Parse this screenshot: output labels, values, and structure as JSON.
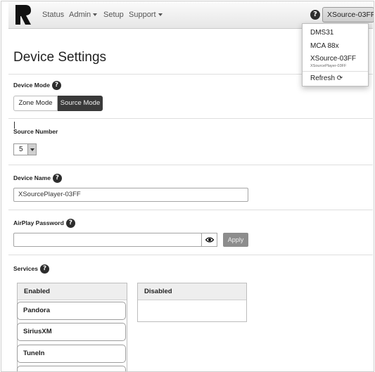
{
  "nav": {
    "items": [
      {
        "label": "Status",
        "dropdown": false
      },
      {
        "label": "Admin",
        "dropdown": true
      },
      {
        "label": "Setup",
        "dropdown": false
      },
      {
        "label": "Support",
        "dropdown": true
      }
    ],
    "help_glyph": "?",
    "device_button_label": "XSource-03FF"
  },
  "device_menu": {
    "items": [
      {
        "label": "DMS31"
      },
      {
        "label": "MCA 88x"
      },
      {
        "label": "XSource-03FF",
        "sublabel": "XSourcePlayer-03FF"
      }
    ],
    "refresh_label": "Refresh",
    "refresh_icon": "refresh-icon"
  },
  "page": {
    "title": "Device Settings"
  },
  "device_mode": {
    "label": "Device Mode",
    "options": [
      "Zone Mode",
      "Source Mode"
    ],
    "selected": "Source Mode"
  },
  "source_number": {
    "label": "Source Number",
    "value": "5"
  },
  "device_name": {
    "label": "Device Name",
    "value": "XSourcePlayer-03FF"
  },
  "airplay": {
    "label": "AirPlay Password",
    "value": "",
    "apply_label": "Apply",
    "reveal_icon": "eye-icon"
  },
  "services": {
    "label": "Services",
    "enabled_header": "Enabled",
    "disabled_header": "Disabled",
    "enabled": [
      "Pandora",
      "SiriusXM",
      "TuneIn"
    ],
    "disabled": []
  },
  "colors": {
    "navbar": "#e6e6e6",
    "selected_mode": "#3a3a3a",
    "apply_button": "#8d8d8d",
    "help_badge": "#2d2d2d"
  }
}
